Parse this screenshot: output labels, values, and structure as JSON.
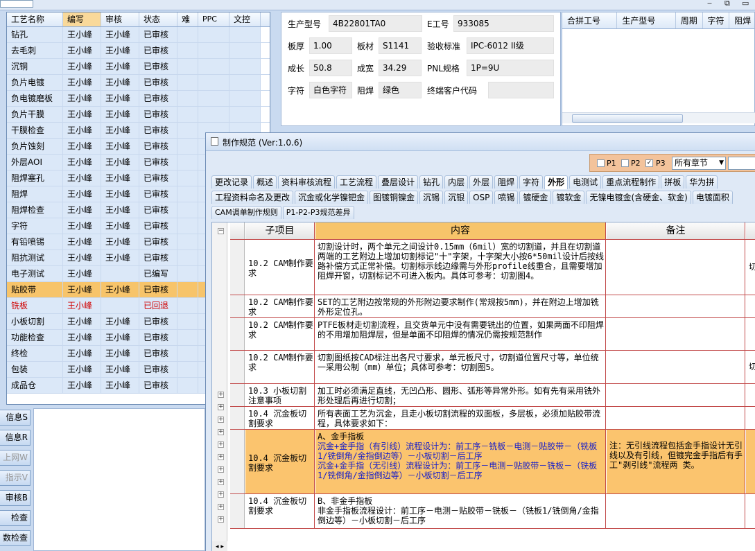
{
  "window_controls": [
    "‒",
    "⧉",
    "▭"
  ],
  "process_grid": {
    "headers": [
      "工艺名称",
      "编写",
      "审核",
      "状态",
      "难",
      "PPC",
      "文控"
    ],
    "rows": [
      {
        "name": "钻孔",
        "writer": "王小峰",
        "reviewer": "王小峰",
        "status": "已审核"
      },
      {
        "name": "去毛刺",
        "writer": "王小峰",
        "reviewer": "王小峰",
        "status": "已审核"
      },
      {
        "name": "沉铜",
        "writer": "王小峰",
        "reviewer": "王小峰",
        "status": "已审核"
      },
      {
        "name": "负片电镀",
        "writer": "王小峰",
        "reviewer": "王小峰",
        "status": "已审核"
      },
      {
        "name": "负电镀磨板",
        "writer": "王小峰",
        "reviewer": "王小峰",
        "status": "已审核"
      },
      {
        "name": "负片干膜",
        "writer": "王小峰",
        "reviewer": "王小峰",
        "status": "已审核"
      },
      {
        "name": "干膜检查",
        "writer": "王小峰",
        "reviewer": "王小峰",
        "status": "已审核"
      },
      {
        "name": "负片蚀刻",
        "writer": "王小峰",
        "reviewer": "王小峰",
        "status": "已审核"
      },
      {
        "name": "外层AOI",
        "writer": "王小峰",
        "reviewer": "王小峰",
        "status": "已审核"
      },
      {
        "name": "阻焊塞孔",
        "writer": "王小峰",
        "reviewer": "王小峰",
        "status": "已审核"
      },
      {
        "name": "阻焊",
        "writer": "王小峰",
        "reviewer": "王小峰",
        "status": "已审核"
      },
      {
        "name": "阻焊检查",
        "writer": "王小峰",
        "reviewer": "王小峰",
        "status": "已审核"
      },
      {
        "name": "字符",
        "writer": "王小峰",
        "reviewer": "王小峰",
        "status": "已审核"
      },
      {
        "name": "有铅喷锡",
        "writer": "王小峰",
        "reviewer": "王小峰",
        "status": "已审核"
      },
      {
        "name": "阻抗测试",
        "writer": "王小峰",
        "reviewer": "王小峰",
        "status": "已审核"
      },
      {
        "name": "电子测试",
        "writer": "王小峰",
        "reviewer": "",
        "status": "已编写"
      },
      {
        "name": "贴胶带",
        "writer": "王小峰",
        "reviewer": "王小峰",
        "status": "已审核"
      },
      {
        "name": "铣板",
        "writer": "王小峰",
        "reviewer": "",
        "status": "已回退"
      },
      {
        "name": "小板切割",
        "writer": "王小峰",
        "reviewer": "王小峰",
        "status": "已审核"
      },
      {
        "name": "功能检查",
        "writer": "王小峰",
        "reviewer": "王小峰",
        "status": "已审核"
      },
      {
        "name": "终检",
        "writer": "王小峰",
        "reviewer": "王小峰",
        "status": "已审核"
      },
      {
        "name": "包装",
        "writer": "王小峰",
        "reviewer": "王小峰",
        "status": "已审核"
      },
      {
        "name": "成品仓",
        "writer": "王小峰",
        "reviewer": "王小峰",
        "status": "已审核"
      }
    ]
  },
  "left_buttons": [
    "信息S",
    "信息R",
    "上网W",
    "指示V",
    "审核B",
    "检查",
    "数检查"
  ],
  "info_panel": {
    "model_label": "生产型号",
    "model_value": "4B22801TA0",
    "eno_label": "E工号",
    "eno_value": "933085",
    "thickness_label": "板厚",
    "thickness_value": "1.00",
    "material_label": "板材",
    "material_value": "S1141",
    "standard_label": "验收标准",
    "standard_value": "IPC-6012 II级",
    "length_label": "成长",
    "length_value": "50.8",
    "width_label": "成宽",
    "width_value": "34.29",
    "pnl_label": "PNL规格",
    "pnl_value": "1P=9U",
    "char_label": "字符",
    "char_value": "白色字符",
    "mask_label": "阻焊",
    "mask_value": "绿色",
    "customer_label": "终端客户代码",
    "customer_value": ""
  },
  "combo_grid": {
    "headers": [
      "合拼工号",
      "生产型号",
      "周期",
      "字符",
      "阻焊"
    ]
  },
  "dialog": {
    "title": "制作规范 (Ver:1.0.6)",
    "filter": {
      "p1": "P1",
      "p2": "P2",
      "p3": "P3",
      "chapter": "所有章节"
    },
    "tabs_row1": [
      "更改记录",
      "概述",
      "资料审核流程",
      "工艺流程",
      "叠层设计",
      "钻孔",
      "内层",
      "外层",
      "阻焊",
      "字符",
      "外形",
      "电测试",
      "重点流程制作",
      "拼板",
      "华为拼"
    ],
    "tabs_row2": [
      "工程资料命名及更改",
      "沉金或化学镍钯金",
      "图镀铜镍金",
      "沉锡",
      "沉银",
      "OSP",
      "喷锡",
      "镀硬金",
      "镀软金",
      "无镍电镀金(含硬金、软金)",
      "电镀面积"
    ],
    "tabs_row3": [
      "CAM调单制作规则",
      "P1-P2-P3规范差异"
    ],
    "active_tab": "外形",
    "table_headers": {
      "sub": "子项目",
      "content": "内容",
      "note": "备注"
    },
    "rows": [
      {
        "sub": "10.2 CAM制作要求",
        "content": "切割设计时，两个单元之间设计0.15mm（6mil）宽的切割道，并且在切割道两端的工艺附边上增加切割标记\"十\"字架，十字架大小按6*50mil设计后按线路补偿方式正常补偿。切割标示线边缘需与外形profile线重合，且需要增加阻焊开窗，切割标记不可进入板内。具体可参考：切割图4。",
        "note": "",
        "extra": "切"
      },
      {
        "sub": "10.2 CAM制作要求",
        "content": "SET的工艺附边按常规的外形附边要求制作(常规按5mm)，并在附边上增加铣外形定位孔。",
        "note": "",
        "extra": ""
      },
      {
        "sub": "10.2 CAM制作要求",
        "content": "PTFE板材走切割流程，且交货单元中没有需要铣出的位置，如果两面不印阻焊的不用增加阻焊层，但是单面不印阻焊的情况仍需按规范制作",
        "note": "",
        "extra": ""
      },
      {
        "sub": "10.2 CAM制作要求",
        "content": "切割图纸按CAD标注出各尺寸要求，单元板尺寸，切割道位置尺寸等，单位统一采用公制（mm）单位；具体可参考：切割图5。",
        "note": "",
        "extra": "切"
      },
      {
        "sub": "10.3 小板切割注意事项",
        "content": "加工时必须满足直线，无凹凸形、圆形、弧形等异常外形。如有先有采用铣外形处理后再进行切割；",
        "note": "",
        "extra": ""
      },
      {
        "sub": "10.4 沉金板切割要求",
        "content": "所有表面工艺为沉金，且走小板切割流程的双面板，多层板，必须加贴胶带流程，具体要求如下：",
        "note": "",
        "extra": ""
      },
      {
        "sub": "10.4 沉金板切割要求",
        "content": "A、金手指板",
        "content_red": "沉金+金手指（有引线）流程设计为：前工序－铣板－电测－贴胶带－（铣板1/铣倒角/金指倒边等）－小板切割－后工序\n沉金+金手指（无引线）流程设计为：前工序－电测－贴胶带－铣板－（铣板1/铣倒角/金指倒边等）－小板切割－后工序",
        "note": "注：无引线流程包括金手指设计无引线以及有引线，但镀完金手指后有手工\"剥引线\"流程两 类。",
        "extra": "",
        "highlight": true
      },
      {
        "sub": "10.4 沉金板切割要求",
        "content": "B、非金手指板\n非金手指板流程设计：前工序－电测－贴胶带－铣板－（铣板1/铣倒角/金指倒边等）－小板切割－后工序",
        "note": "",
        "extra": ""
      }
    ]
  }
}
